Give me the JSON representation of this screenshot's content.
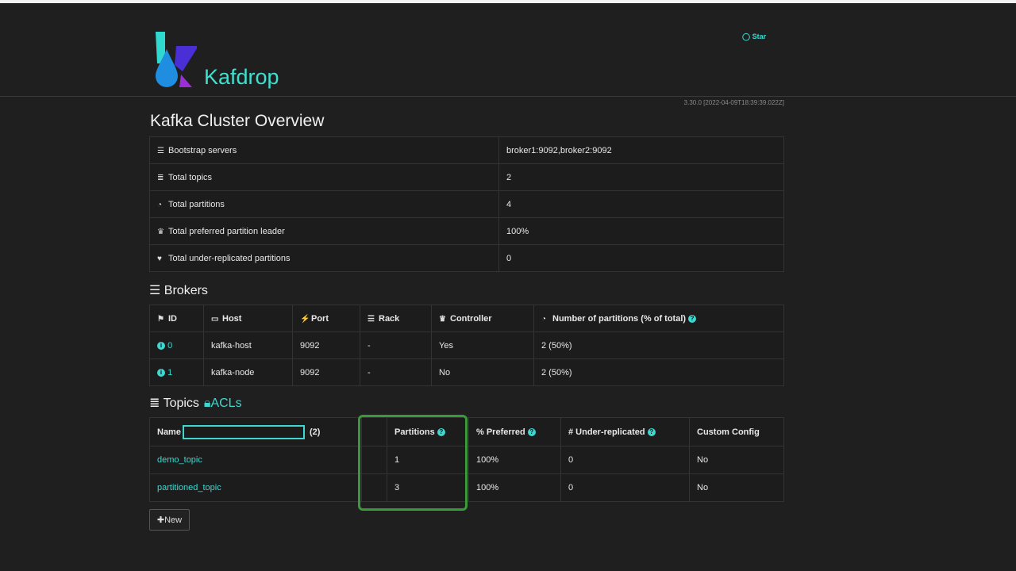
{
  "header": {
    "brand": "Kafdrop",
    "star": "Star",
    "version": "3.30.0 [2022-04-09T18:39:39.022Z]"
  },
  "title": "Kafka Cluster Overview",
  "overview": [
    {
      "icon": "server-icon",
      "label": "Bootstrap servers",
      "value": "broker1:9092,broker2:9092"
    },
    {
      "icon": "database-icon",
      "label": "Total topics",
      "value": "2"
    },
    {
      "icon": "pie-chart-icon",
      "label": "Total partitions",
      "value": "4"
    },
    {
      "icon": "trophy-icon",
      "label": "Total preferred partition leader",
      "value": "100%"
    },
    {
      "icon": "heartbeat-icon",
      "label": "Total under-replicated partitions",
      "value": "0"
    }
  ],
  "brokers": {
    "heading": "Brokers",
    "columns": [
      "ID",
      "Host",
      "Port",
      "Rack",
      "Controller",
      "Number of partitions (% of total)"
    ],
    "rows": [
      [
        "0",
        "kafka-host",
        "9092",
        "-",
        "Yes",
        "2 (50%)"
      ],
      [
        "1",
        "kafka-node",
        "9092",
        "-",
        "No",
        "2 (50%)"
      ]
    ]
  },
  "topics": {
    "heading": "Topics",
    "acls": "ACLs",
    "name_label": "Name",
    "filter_value": "",
    "count": "(2)",
    "columns": [
      "Partitions",
      "% Preferred",
      "# Under-replicated",
      "Custom Config"
    ],
    "rows": [
      [
        "demo_topic",
        "1",
        "100%",
        "0",
        "No"
      ],
      [
        "partitioned_topic",
        "3",
        "100%",
        "0",
        "No"
      ]
    ],
    "new_button": "New"
  },
  "colors": {
    "accent": "#3ed8d0",
    "highlight": "#3a9a3a"
  }
}
